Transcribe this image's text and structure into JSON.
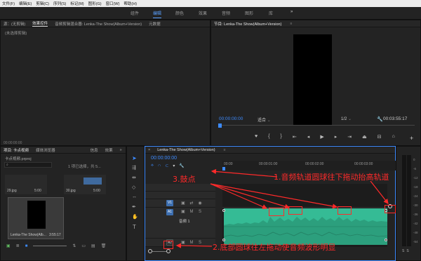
{
  "menubar": {
    "items": [
      "文件(F)",
      "编辑(E)",
      "剪辑(C)",
      "序列(S)",
      "标记(M)",
      "图形(G)",
      "窗口(W)",
      "帮助(H)"
    ]
  },
  "workspaces": {
    "items": [
      "组件",
      "编辑",
      "颜色",
      "效果",
      "音频",
      "图形",
      "库"
    ],
    "active": "编辑",
    "more": "»"
  },
  "source_panel": {
    "tabs": [
      "源：(无剪辑)",
      "效果控件",
      "音频剪辑混合器: Lenka-The Show(Album+Version)",
      "元数据"
    ],
    "clip_selector": "(未选择剪辑)",
    "timecode": "00:00:00:00"
  },
  "program_panel": {
    "title": "节目: Lenka-The Show(Album+Version)",
    "timecode_current": "00:00:00:00",
    "fit": "适合",
    "resolution": "1/2",
    "timecode_duration": "00:03:55:17"
  },
  "project_panel": {
    "tabs": [
      "项目: 卡点视频",
      "媒体浏览器",
      "信息",
      "效果"
    ],
    "more": "»",
    "project_file": "卡点视频.prproj",
    "selection_info": "1 项已选择，共 5...",
    "items": [
      {
        "name": "29.jpg",
        "duration": "5:00"
      },
      {
        "name": "30.jpg",
        "duration": "5:00"
      },
      {
        "name": "Lenka-The Show(Alb...",
        "duration": "3:55:17"
      }
    ]
  },
  "timeline": {
    "sequence_title": "Lenka-The Show(Album+Version)",
    "timecode": "00:00:00:00",
    "ruler_labels": [
      "00:00",
      "00:00:01:00",
      "00:00:02:00",
      "00:00:03:00"
    ],
    "tracks": [
      {
        "id": "V1",
        "type": "video"
      },
      {
        "id": "A1",
        "type": "audio"
      },
      {
        "id": "A2",
        "type": "audio"
      }
    ],
    "audio_label": "音频 1",
    "meter_labels": [
      "0",
      "-6",
      "-12",
      "-18",
      "-24",
      "-30",
      "-36",
      "-42",
      "-48",
      "-54"
    ],
    "meter_footer": [
      "S",
      "S"
    ]
  },
  "annotations": {
    "label1": "1.音频轨道圆球往下拖动抬高轨道",
    "label2": "2.底部圆球往左拖动使音频波形明显",
    "label3": "3.鼓点"
  },
  "colors": {
    "accent": "#3d8bff",
    "audio_clip": "#36c09a",
    "annotation": "#ff2a2a"
  }
}
